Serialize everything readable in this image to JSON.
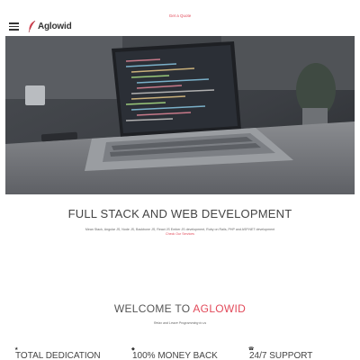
{
  "topbar": {
    "link_label": "Get a Quote"
  },
  "nav": {
    "menu_icon": "hamburger-menu-icon",
    "logo_text": "Aglowid",
    "logo_icon": "feather-logo-icon"
  },
  "hero": {
    "image": "laptop-code-editor-photo"
  },
  "intro": {
    "title": "FULL STACK AND WEB DEVELOPMENT",
    "subtitle": "Mean Stack, Angular JS, Node JS, Backbone JS, React JS Ember JS development, Ruby on Rails, PHP and ASP.NET development",
    "link": "Check Our Services"
  },
  "welcome": {
    "title_prefix": "WELCOME TO ",
    "title_accent": "AGLOWID",
    "tagline": "Relax and Leave Programming to us"
  },
  "features": [
    {
      "icon": "trophy-icon",
      "title": "TOTAL DEDICATION"
    },
    {
      "icon": "money-icon",
      "title": "100% MONEY BACK"
    },
    {
      "icon": "headset-icon",
      "title": "24/7 SUPPORT"
    }
  ],
  "colors": {
    "accent": "#e24a5a",
    "text": "#444444",
    "hero_bg": "#3a3d42"
  }
}
